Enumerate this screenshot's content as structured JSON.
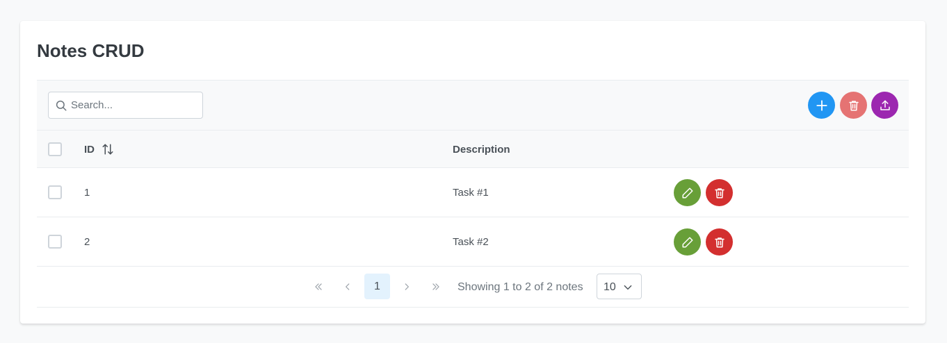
{
  "page": {
    "title": "Notes CRUD"
  },
  "toolbar": {
    "search_placeholder": "Search...",
    "search_value": "",
    "buttons": [
      {
        "name": "add",
        "icon": "plus-icon",
        "color": "#2196f3"
      },
      {
        "name": "delete-selected",
        "icon": "trash-icon",
        "color": "#e57373",
        "disabled": true
      },
      {
        "name": "export",
        "icon": "upload-icon",
        "color": "#9c27b0"
      }
    ]
  },
  "table": {
    "columns": [
      "ID",
      "Description"
    ],
    "rows": [
      {
        "id": "1",
        "description": "Task #1"
      },
      {
        "id": "2",
        "description": "Task #2"
      }
    ],
    "edit_color": "#689f38",
    "delete_color": "#d32f2f"
  },
  "paginator": {
    "current_page": "1",
    "report": "Showing 1 to 2 of 2 notes",
    "rows_per_page": "10"
  }
}
